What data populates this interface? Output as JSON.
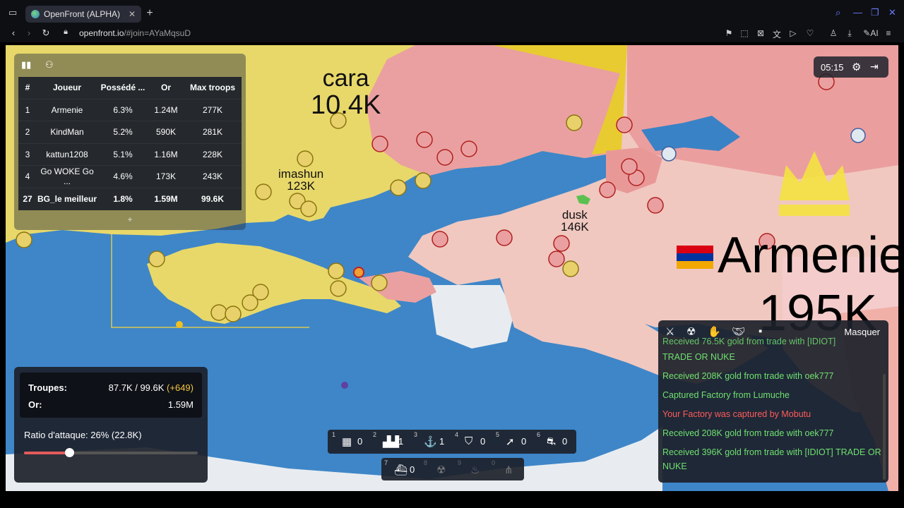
{
  "browser": {
    "tab_title": "OpenFront (ALPHA)",
    "url_domain": "openfront.io",
    "url_path": "/#join=AYaMqsuD"
  },
  "map": {
    "labels": [
      {
        "name": "cara",
        "value": "10.4K"
      },
      {
        "name": "imashun",
        "value": "123K"
      },
      {
        "name": "dusk",
        "value": "146K"
      },
      {
        "name": "Armenie",
        "value": "195K"
      }
    ],
    "flag_colors": [
      "#d90012",
      "#0033a0",
      "#f2a800"
    ],
    "progress_colors": [
      "#e8322e",
      "#3a6fe0",
      "#e0c030"
    ]
  },
  "leaderboard": {
    "headers": [
      "#",
      "Joueur",
      "Possédé ...",
      "Or",
      "Max troops"
    ],
    "rows": [
      [
        "1",
        "Armenie",
        "6.3%",
        "1.24M",
        "277K"
      ],
      [
        "2",
        "KindMan",
        "5.2%",
        "590K",
        "281K"
      ],
      [
        "3",
        "kattun1208",
        "5.1%",
        "1.16M",
        "228K"
      ],
      [
        "4",
        "Go WOKE Go ...",
        "4.6%",
        "173K",
        "243K"
      ],
      [
        "27",
        "BG_le meilleur",
        "1.8%",
        "1.59M",
        "99.6K"
      ]
    ],
    "plus": "+"
  },
  "clock": {
    "time": "05:15"
  },
  "stats": {
    "troops_label": "Troupes:",
    "troops_value": "87.7K / 99.6K",
    "troops_increase": "(+649)",
    "gold_label": "Or:",
    "gold_value": "1.59M",
    "ratio_label": "Ratio d'attaque: 26% (22.8K)",
    "ratio_fraction": 0.26
  },
  "build_bar": {
    "row1": [
      {
        "key": "1",
        "icon": "city-icon",
        "count": "0"
      },
      {
        "key": "2",
        "icon": "factory-icon",
        "count": "1"
      },
      {
        "key": "3",
        "icon": "port-icon",
        "count": "1"
      },
      {
        "key": "4",
        "icon": "defense-post-icon",
        "count": "0"
      },
      {
        "key": "5",
        "icon": "missile-silo-icon",
        "count": "0"
      },
      {
        "key": "6",
        "icon": "sam-launcher-icon",
        "count": "0"
      }
    ],
    "row2": [
      {
        "key": "7",
        "icon": "warship-icon",
        "count": "0"
      },
      {
        "key": "8",
        "icon": "atom-bomb-icon",
        "count": ""
      },
      {
        "key": "9",
        "icon": "hydrogen-bomb-icon",
        "count": ""
      },
      {
        "key": "0",
        "icon": "mirv-icon",
        "count": ""
      }
    ]
  },
  "events": {
    "hide_label": "Masquer",
    "icons": [
      "sword-icon",
      "radiation-icon",
      "hand-gold-icon",
      "handshake-icon",
      "chat-icon"
    ],
    "cut_off": "Received 76.5K gold from trade with [IDIOT]",
    "items": [
      {
        "text": "TRADE OR NUKE",
        "color": "green"
      },
      {
        "text": "Received 208K gold from trade with oek777",
        "color": "green"
      },
      {
        "text": "Captured Factory from Lumuche",
        "color": "green"
      },
      {
        "text": "Your Factory was captured by Mobutu",
        "color": "red"
      },
      {
        "text": "Received 208K gold from trade with oek777",
        "color": "green"
      },
      {
        "text": "Received 396K gold from trade with [IDIOT] TRADE OR NUKE",
        "color": "green"
      }
    ]
  }
}
